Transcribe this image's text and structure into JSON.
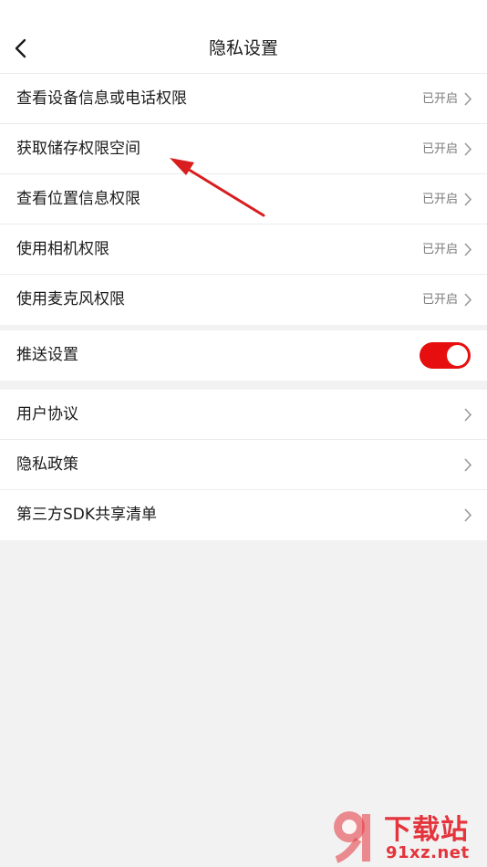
{
  "header": {
    "title": "隐私设置",
    "back_icon": "chevron-left-icon"
  },
  "permissions": {
    "items": [
      {
        "label": "查看设备信息或电话权限",
        "status": "已开启"
      },
      {
        "label": "获取储存权限空间",
        "status": "已开启"
      },
      {
        "label": "查看位置信息权限",
        "status": "已开启"
      },
      {
        "label": "使用相机权限",
        "status": "已开启"
      },
      {
        "label": "使用麦克风权限",
        "status": "已开启"
      }
    ]
  },
  "push": {
    "label": "推送设置",
    "enabled": true
  },
  "legal": {
    "items": [
      {
        "label": "用户协议"
      },
      {
        "label": "隐私政策"
      },
      {
        "label": "第三方SDK共享清单"
      }
    ]
  },
  "watermark": {
    "name": "下载站",
    "site": "91xz.net"
  },
  "colors": {
    "accent": "#e60e0e",
    "arrow": "#d81e1e",
    "watermark": "#e4343c",
    "background": "#f2f2f2"
  }
}
